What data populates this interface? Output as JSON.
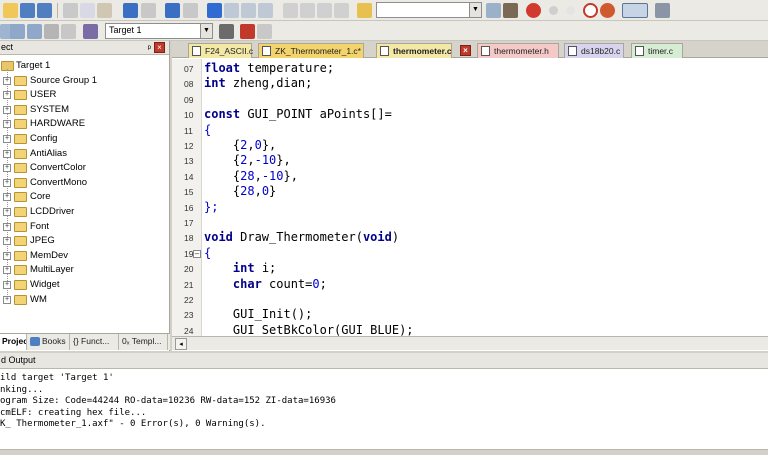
{
  "toolbar2": {
    "target_combo": "Target 1"
  },
  "project_panel": {
    "title": "ect",
    "pin": "ᵖ",
    "root": "Target 1",
    "groups": [
      "Source Group 1",
      "USER",
      "SYSTEM",
      "HARDWARE",
      "Config",
      "AntiAlias",
      "ConvertColor",
      "ConvertMono",
      "Core",
      "LCDDriver",
      "Font",
      "JPEG",
      "MemDev",
      "MultiLayer",
      "Widget",
      "WM"
    ],
    "tabs": [
      "Project",
      "Books",
      "{} Funct...",
      "0ₓ Templ..."
    ]
  },
  "file_tabs": [
    {
      "label": "F24_ASCII.c"
    },
    {
      "label": "ZK_Thermometer_1.c*"
    },
    {
      "label": "thermometer.c"
    },
    {
      "label": "thermometer.h"
    },
    {
      "label": "ds18b20.c"
    },
    {
      "label": "timer.c"
    }
  ],
  "code": {
    "line_numbers": [
      "07",
      "08",
      "09",
      "10",
      "11",
      "12",
      "13",
      "14",
      "15",
      "16",
      "17",
      "18",
      "19",
      "20",
      "21",
      "22",
      "23",
      "24"
    ],
    "lines": [
      "float temperature;",
      "int zheng,dian;",
      "",
      "const GUI_POINT aPoints[]=",
      "{",
      "    {2,0},",
      "    {2,-10},",
      "    {28,-10},",
      "    {28,0}",
      "};",
      "",
      "void Draw_Thermometer(void)",
      "{",
      "    int i;",
      "    char count=0;",
      "",
      "    GUI_Init();",
      "    GUI_SetBkColor(GUI_BLUE);"
    ]
  },
  "build_output": {
    "title": "d Output",
    "lines": [
      "ild target 'Target 1'",
      "nking...",
      "ogram Size: Code=44244 RO-data=10236 RW-data=152 ZI-data=16936",
      "cmELF: creating hex file...",
      "K_ Thermometer_1.axf\" - 0 Error(s), 0 Warning(s)."
    ]
  },
  "colors": {
    "keyword": "#00008b",
    "number": "#0000cc",
    "tab_c": "#f3e8a6",
    "tab_h": "#f6c9c9",
    "tab_active": "#f3d36b"
  }
}
